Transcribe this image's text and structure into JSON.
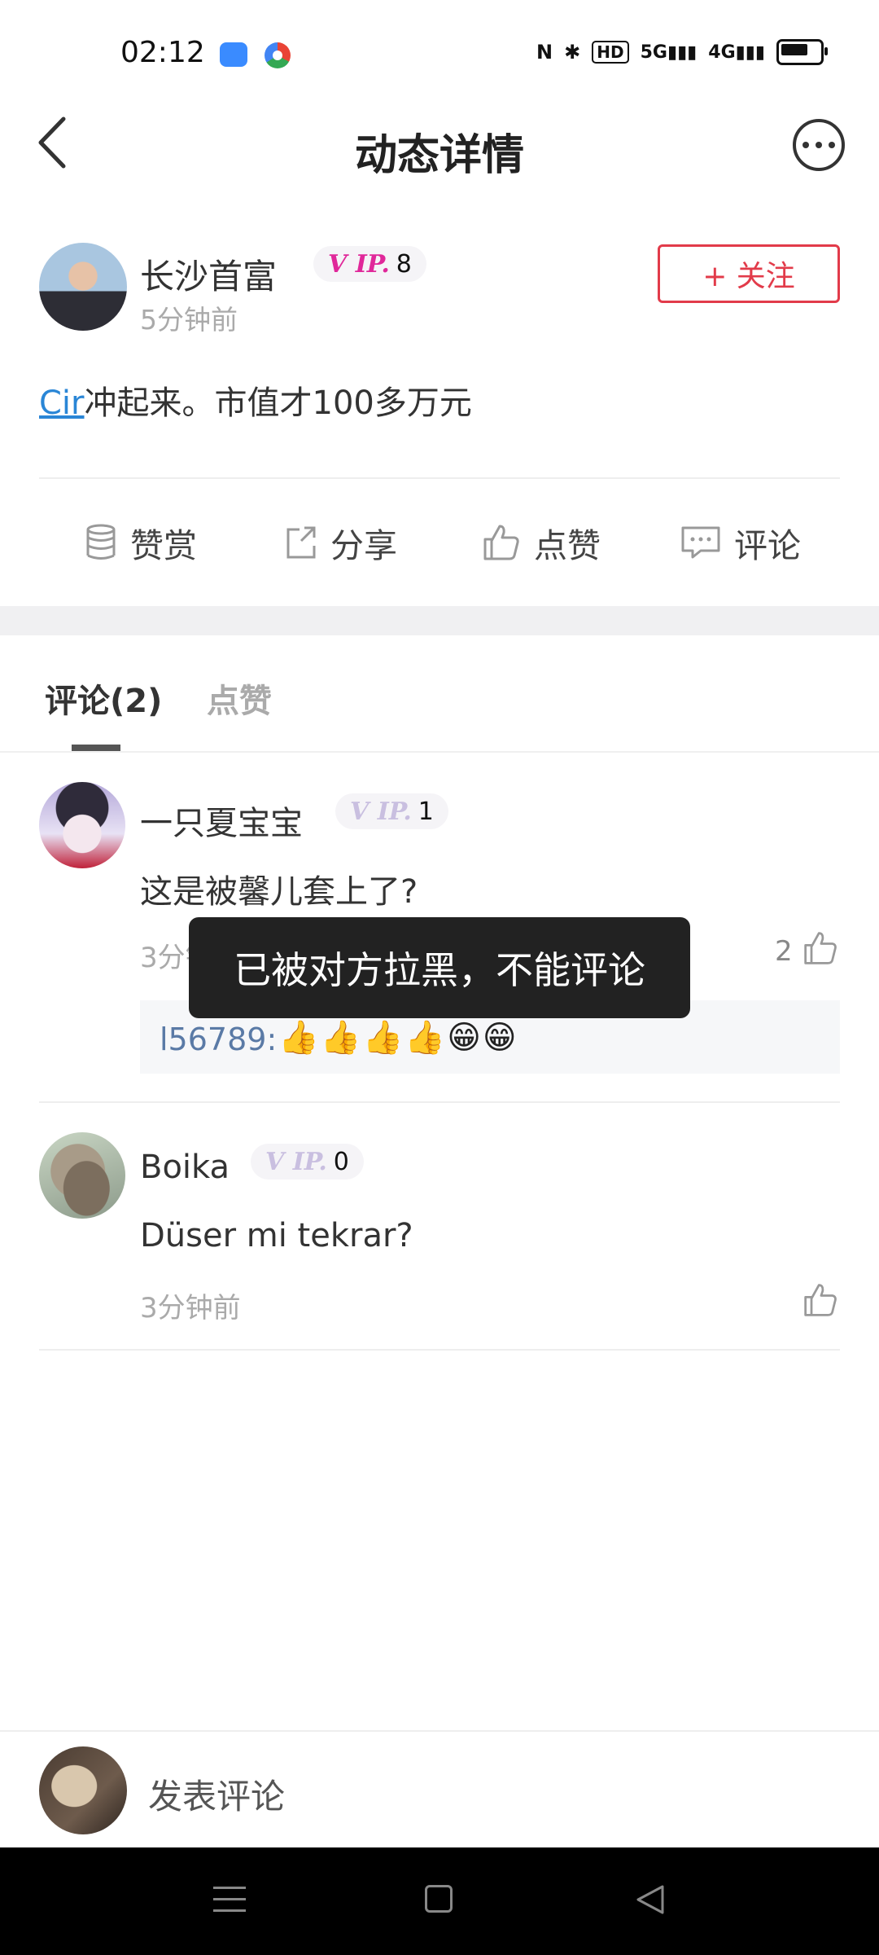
{
  "status_bar": {
    "time": "02:12",
    "icons": [
      "nfc-icon",
      "bluetooth-icon",
      "hd-icon",
      "signal-5g-icon",
      "signal-4g-icon",
      "battery-icon"
    ],
    "hd_label": "HD",
    "net1": "5G",
    "net2": "4G"
  },
  "header": {
    "title": "动态详情",
    "back_icon": "chevron-left-icon",
    "more_icon": "more-dots-icon"
  },
  "post": {
    "author": {
      "name": "长沙首富",
      "vip_label": "V IP.",
      "vip_level": "8",
      "time": "5分钟前"
    },
    "follow_label": "+ 关注",
    "content_link": "Cir",
    "content_text": "冲起来。市值才100多万元"
  },
  "actions": [
    {
      "label": "赞赏",
      "icon": "coins-icon"
    },
    {
      "label": "分享",
      "icon": "share-icon"
    },
    {
      "label": "点赞",
      "icon": "thumbs-up-icon"
    },
    {
      "label": "评论",
      "icon": "comment-icon"
    }
  ],
  "tabs": {
    "comments": "评论(2)",
    "likes": "点赞"
  },
  "comments": [
    {
      "name": "一只夏宝宝",
      "vip_label": "V IP.",
      "vip_level": "1",
      "text": "这是被馨儿套上了?",
      "time": "3分钟前",
      "likes": "2",
      "reply_user": "l56789:",
      "reply_emojis": "👍👍👍👍😁😁"
    },
    {
      "name": "Boika",
      "vip_label": "V IP.",
      "vip_level": "0",
      "text": "Düser mi tekrar?",
      "time": "3分钟前"
    }
  ],
  "toast": "已被对方拉黑，不能评论",
  "bottom_bar": {
    "placeholder": "发表评论"
  },
  "colors": {
    "accent_red": "#e23b4a",
    "link_blue": "#2a86d6",
    "vip_pink": "#e0289a",
    "vip_light": "#c9bfe0"
  }
}
